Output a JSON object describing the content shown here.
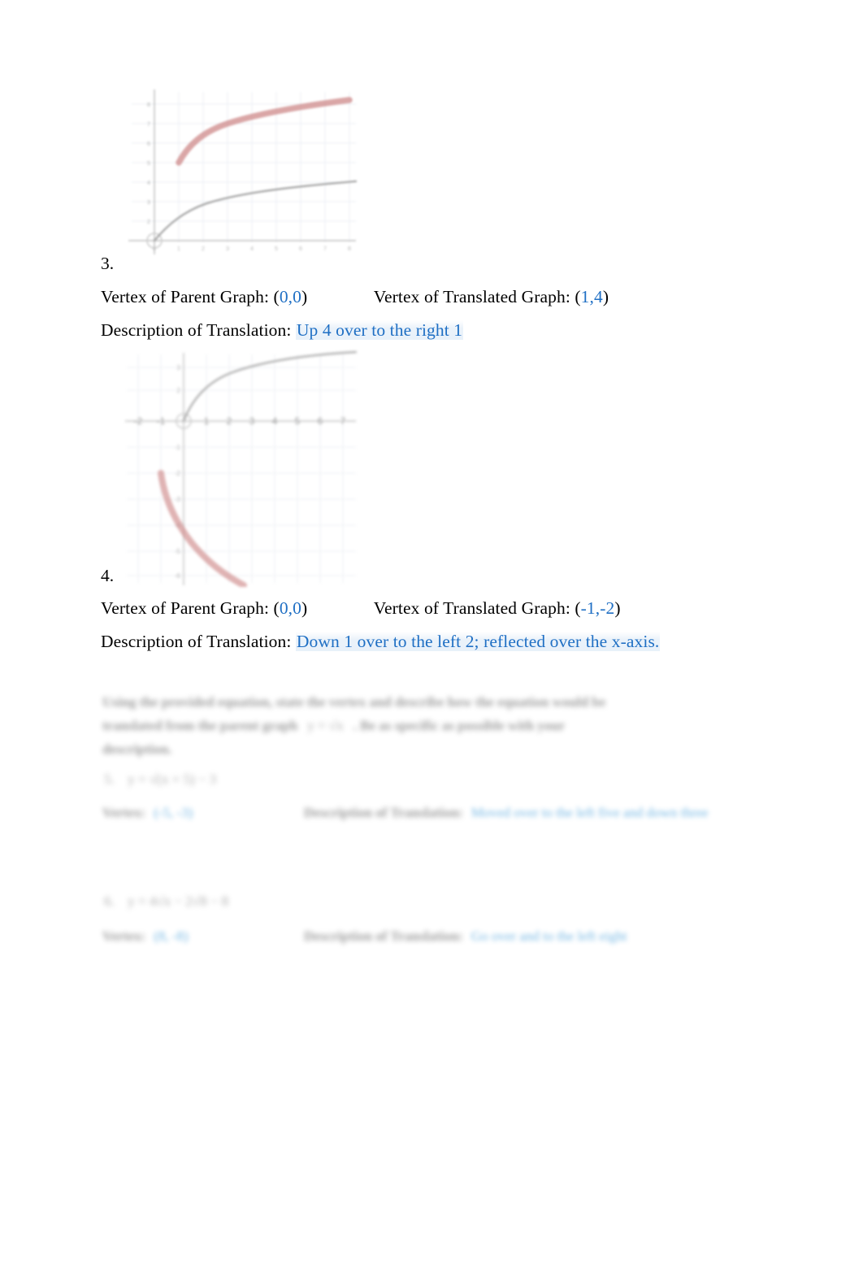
{
  "document": {
    "type": "worksheet",
    "subject": "Square root function translations",
    "page_background": "#ffffff",
    "accent_blue": "#1f6fc4",
    "curve_red": "#c87a7a",
    "curve_gray": "#9a9a9a"
  },
  "items": [
    {
      "number": "3.",
      "parent_label": "Vertex of Parent Graph: (",
      "parent_value_x": "0",
      "parent_comma": ",",
      "parent_value_y": "0",
      "parent_close": ")",
      "translated_label": "Vertex of Translated Graph: (",
      "translated_value_x": "1",
      "translated_comma": ",",
      "translated_value_y": "4",
      "translated_close": ")",
      "description_label": "Description of Translation:",
      "description_answer": "Up 4 over to the right 1"
    },
    {
      "number": "4.",
      "parent_label": "Vertex of Parent Graph: (",
      "parent_value_x": "0",
      "parent_comma": ",",
      "parent_value_y": "0",
      "parent_close": ")",
      "translated_label": "Vertex of Translated Graph: (",
      "translated_value_x": "-1",
      "translated_comma": ",",
      "translated_value_y": "-2",
      "translated_close": ")",
      "description_label": "Description of Translation:",
      "description_answer": "Down 1 over to the left 2; reflected over the x-axis."
    }
  ],
  "bottom_section": {
    "instructions_line1": "Using the provided equation, state the vertex and describe how the equation would be",
    "instructions_line2": "translated from the parent graph",
    "instructions_inline_equation": "y = √x",
    "instructions_line2_tail": ". Be as specific as possible with your",
    "instructions_line3": "description.",
    "problems": [
      {
        "number": "5.",
        "equation": "y = √(x + 5)  − 3",
        "vertex_label": "Vertex:",
        "vertex_value": "(-5, -3)",
        "description_label": "Description of Translation:",
        "description_answer": "Moved over to the left five and down three"
      },
      {
        "number": "6.",
        "equation": "y = 4√x  − 2√8  − 8",
        "vertex_label": "Vertex:",
        "vertex_value": "(8, -8)",
        "description_label": "Description of Translation:",
        "description_answer": "Go over and to the left eight"
      }
    ]
  },
  "chart_data": [
    {
      "id": "graph-3",
      "type": "line",
      "title": "",
      "xlabel": "",
      "ylabel": "",
      "xlim": [
        -2,
        10
      ],
      "ylim": [
        -1,
        9
      ],
      "grid": true,
      "legend": "none",
      "series": [
        {
          "name": "parent-graph",
          "color": "#9a9a9a",
          "equation": "y = sqrt(x)",
          "x": [
            0,
            1,
            2,
            3,
            4,
            5,
            6,
            7,
            8,
            9
          ],
          "y": [
            0,
            1,
            1.41,
            1.73,
            2,
            2.24,
            2.45,
            2.65,
            2.83,
            3
          ]
        },
        {
          "name": "translated-graph",
          "color": "#c87a7a",
          "equation": "y = sqrt(x - 1) + 4",
          "vertex": [
            1,
            4
          ],
          "x": [
            1,
            2,
            3,
            4,
            5,
            6,
            7,
            8,
            9,
            10
          ],
          "y": [
            4,
            5,
            5.41,
            5.73,
            6,
            6.24,
            6.45,
            6.65,
            6.83,
            7
          ]
        }
      ]
    },
    {
      "id": "graph-4",
      "type": "line",
      "title": "",
      "xlabel": "",
      "ylabel": "",
      "xlim": [
        -4,
        9
      ],
      "ylim": [
        -8,
        4
      ],
      "grid": true,
      "legend": "none",
      "series": [
        {
          "name": "parent-graph",
          "color": "#9a9a9a",
          "equation": "y = sqrt(x)",
          "x": [
            0,
            1,
            2,
            3,
            4,
            5,
            6,
            7,
            8
          ],
          "y": [
            0,
            1,
            1.41,
            1.73,
            2,
            2.24,
            2.45,
            2.65,
            2.83
          ]
        },
        {
          "name": "translated-graph",
          "color": "#c87a7a",
          "equation": "y = -sqrt(x + 1) - 2",
          "vertex": [
            -1,
            -2
          ],
          "x": [
            -1,
            0,
            1,
            2,
            3,
            4,
            5
          ],
          "y": [
            -2,
            -3,
            -3.41,
            -3.73,
            -4,
            -4.24,
            -4.45
          ]
        }
      ]
    }
  ]
}
